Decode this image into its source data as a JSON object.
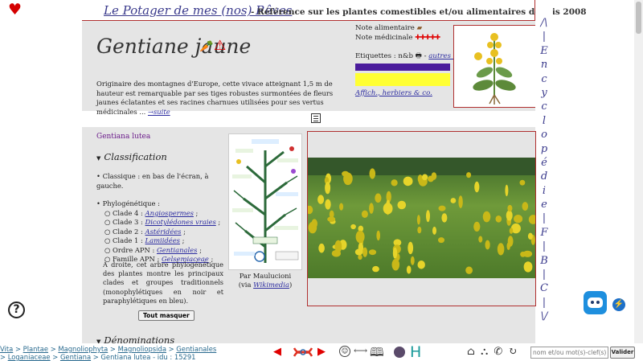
{
  "site": {
    "title": "Le Potager de mes (nos) Rêves",
    "tagline": "- Référence sur les plantes comestibles et/ou alimentaires depuis 2008"
  },
  "plant": {
    "name": "Gentiane jaune",
    "latin": "Gentiana lutea",
    "intro": "Originaire des montagnes d'Europe, cette vivace atteignant 1,5 m de hauteur est remarquable par ses tiges robustes surmontées de fleurs jaunes éclatantes et ses racines charnues utilisées pour ses vertus médicinales ...",
    "intro_more": "→suite"
  },
  "notes": {
    "alimentaire_label": "Note alimentaire",
    "medicinale_label": "Note médicinale",
    "medicinale_value": "✚✚✚✚✚",
    "etiquettes_label": "Etiquettes : n&b",
    "autres_link": "autres ex.",
    "affich_link": "Affich., herbiers & co."
  },
  "encyclopedie": [
    "/\\",
    "|",
    "E",
    "n",
    "c",
    "y",
    "c",
    "l",
    "o",
    "p",
    "é",
    "d",
    "i",
    "e",
    "|",
    "F",
    "|",
    "B",
    "|",
    "C",
    "|",
    "\\/"
  ],
  "classification": {
    "title": "Classification",
    "classique": "Classique : en bas de l'écran, à gauche.",
    "phylo_label": "Phylogénétique :",
    "rows": [
      {
        "label": "Clade 4 :",
        "value": "Angiospermes"
      },
      {
        "label": "Clade 3 :",
        "value": "Dicotylédones vraies"
      },
      {
        "label": "Clade 2 :",
        "value": "Astéridées"
      },
      {
        "label": "Clade 1 :",
        "value": "Lamiidées"
      },
      {
        "label": "Ordre APN :",
        "value": "Gentianales"
      },
      {
        "label": "Famille APN :",
        "value": "Gelsemiaceae"
      }
    ],
    "paragraph": "À droite, cet arbre phylogénétique des plantes montre les principaux clades et groupes traditionnels (monophylétiques en noir et paraphylétiques en bleu).",
    "caption_by": "Par Maulucioni",
    "caption_via": "(via",
    "caption_link": "Wikimedia",
    "caption_end": ")"
  },
  "hide_button": "Tout masquer",
  "denominations_title": "Dénominations",
  "bottom": {
    "crumbs": [
      "Vita",
      "Plantae",
      "Magnoliophyta",
      "Magnoliopsida",
      "Gentianales",
      "Loganiaceae",
      "Gentiana",
      "Gentiana lutea - idu : 15291"
    ],
    "search_placeholder": "nom et/ou mot(s)-clef(s)",
    "valider": "Valider",
    "h_letter": "H"
  },
  "colors": {
    "accent": "#3a3a8c",
    "border": "#b03030",
    "panel": "#e5e5e5",
    "teal": "#1a9a9a"
  }
}
